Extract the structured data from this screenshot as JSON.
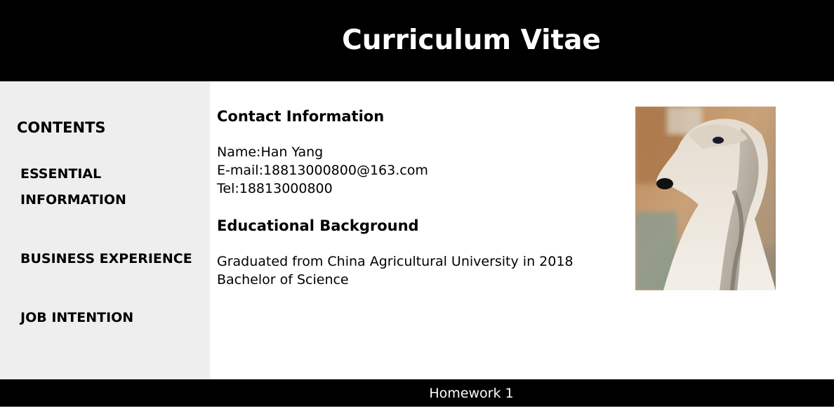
{
  "header": {
    "title": "Curriculum Vitae"
  },
  "sidebar": {
    "title": "CONTENTS",
    "items": [
      {
        "label_line1": "ESSENTIAL",
        "label_line2": "INFORMATION"
      },
      {
        "label": "BUSINESS EXPERIENCE"
      },
      {
        "label": "JOB INTENTION"
      }
    ]
  },
  "main": {
    "contact": {
      "heading": "Contact Information",
      "name": "Name:Han Yang",
      "email": "E-mail:18813000800@163.com",
      "tel": "Tel:18813000800"
    },
    "education": {
      "heading": "Educational Background",
      "line1": "Graduated from China Agricultural University in 2018",
      "line2": "Bachelor of Science"
    },
    "photo": {
      "alt": "profile photo of afghan hound"
    }
  },
  "footer": {
    "text": "Homework 1"
  },
  "colors": {
    "header_bg": "#000000",
    "sidebar_bg": "#eeeeee",
    "footer_bg": "#000000",
    "text": "#000000",
    "header_text": "#ffffff"
  }
}
